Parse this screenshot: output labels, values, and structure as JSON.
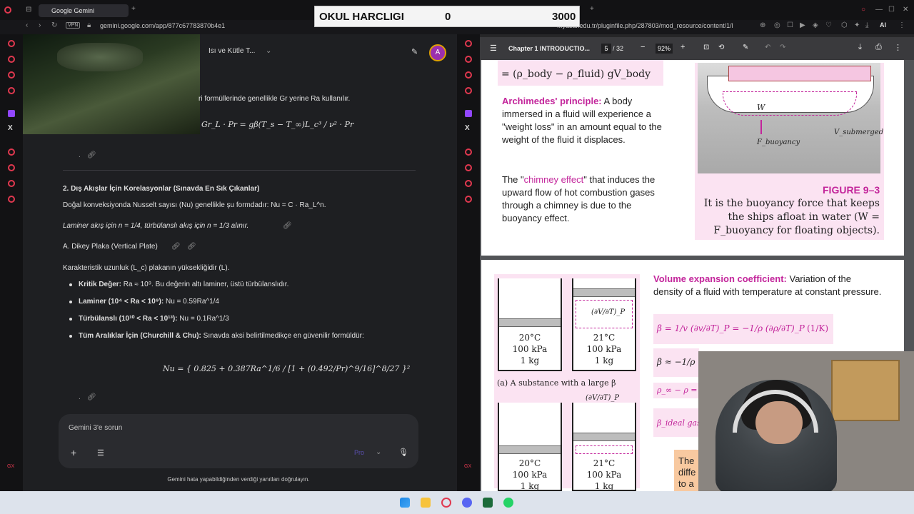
{
  "score_overlay": {
    "label": "OKUL HARCLIGI",
    "value1": "0",
    "value2": "3000"
  },
  "left_browser": {
    "tab_title": "Google Gemini",
    "vpn": "VPN",
    "url": "gemini.google.com/app/877c67783870b4e1",
    "chat_title": "Isı ve Kütle T...",
    "avatar_letter": "A",
    "line1": "ri formüllerinde genellikle Gr yerine Ra kullanılır.",
    "formula_grpr": "Gr_L · Pr = gβ(T_s − T_∞)L_c³ / ν² · Pr",
    "section_title": "2. Dış Akışlar İçin Korelasyonlar (Sınavda En Sık Çıkanlar)",
    "intro": "Doğal konveksiyonda Nusselt sayısı (Nu) genellikle şu formdadır: Nu = C · Ra_L^n.",
    "laminar_note": "Laminer akış için n = 1/4, türbülanslı akış için n = 1/3 alınır.",
    "subsection": "A. Dikey Plaka (Vertical Plate)",
    "char_length": "Karakteristik uzunluk (L_c) plakanın yüksekliğidir (L).",
    "bullets": [
      {
        "label": "Kritik Değer:",
        "text": " Ra ≈ 10⁹. Bu değerin altı laminer, üstü türbülanslıdır."
      },
      {
        "label": "Laminer (10⁴ < Ra < 10⁹):",
        "text": " Nu = 0.59Ra^1/4"
      },
      {
        "label": "Türbülanslı (10¹⁰ < Ra < 10¹³):",
        "text": " Nu = 0.1Ra^1/3"
      },
      {
        "label": "Tüm Aralıklar İçin (Churchill & Chu):",
        "text": " Sınavda aksi belirtilmedikçe en güvenilir formüldür:"
      }
    ],
    "churchill": "Nu = { 0.825 + 0.387Ra^1/6 / [1 + (0.492/Pr)^9/16]^8/27 }²",
    "prompt_placeholder": "Gemini 3'e sorun",
    "model_label": "Pro",
    "disclaimer": "Gemini hata yapabildiğinden verdiği yanıtları doğrulayın."
  },
  "right_browser": {
    "url": "...yasar.edu.tr/pluginfile.php/287803/mod_resource/content/1/l",
    "profile": "AI",
    "pdf_title": "Chapter 1 INTRODUCTIO...",
    "page_current": "5",
    "page_total": "/ 32",
    "zoom": "92%",
    "top_formula": "= (ρ_body − ρ_fluid) gV_body",
    "archimedes_label": "Archimedes' principle:",
    "archimedes_text": "A body immersed in a fluid will experience a \"weight loss\" in an amount equal to the weight of the fluid it displaces.",
    "chimney_pre": "The \"",
    "chimney_link": "chimney effect",
    "chimney_post": "\" that induces the upward flow of hot combustion gases through a chimney is due to the buoyancy effect.",
    "ship_W": "W",
    "ship_F": "F_buoyancy",
    "ship_V": "V_submerged",
    "figure_title": "FIGURE 9–3",
    "figure_caption": "It is the buoyancy force that keeps the ships afloat in water (W = F_buoyancy for floating objects).",
    "vol_label": "Volume expansion coefficient:",
    "vol_text": "Variation of the density of a fluid with temperature at constant pressure.",
    "beta_formula": "β = 1/v (∂v/∂T)_P = −1/ρ (∂ρ/∂T)_P",
    "beta_unit": "(1/K)",
    "beta_approx": "β ≈ −1/ρ",
    "rho_diff": "ρ_∞ − ρ =",
    "beta_ideal": "β_ideal gas",
    "the_diff": "The diffe to a",
    "cyl_left_T": "20°C",
    "cyl_left_P": "100 kPa",
    "cyl_left_m": "1 kg",
    "cyl_right_T": "21°C",
    "cyl_right_P": "100 kPa",
    "cyl_right_m": "1 kg",
    "dvdt": "(∂V/∂T)_P",
    "caption_a": "(a) A substance with a large β",
    "cyl2_left_T": "20°C",
    "cyl2_left_P": "100 kPa",
    "cyl2_left_m": "1 kg",
    "cyl2_right_T": "21°C",
    "cyl2_right_P": "100 kPa",
    "cyl2_right_m": "1 kg"
  },
  "colors": {
    "accent": "#c3259b",
    "sidebar_icon": "#e0384f",
    "taskbar": "#dde3ec"
  }
}
